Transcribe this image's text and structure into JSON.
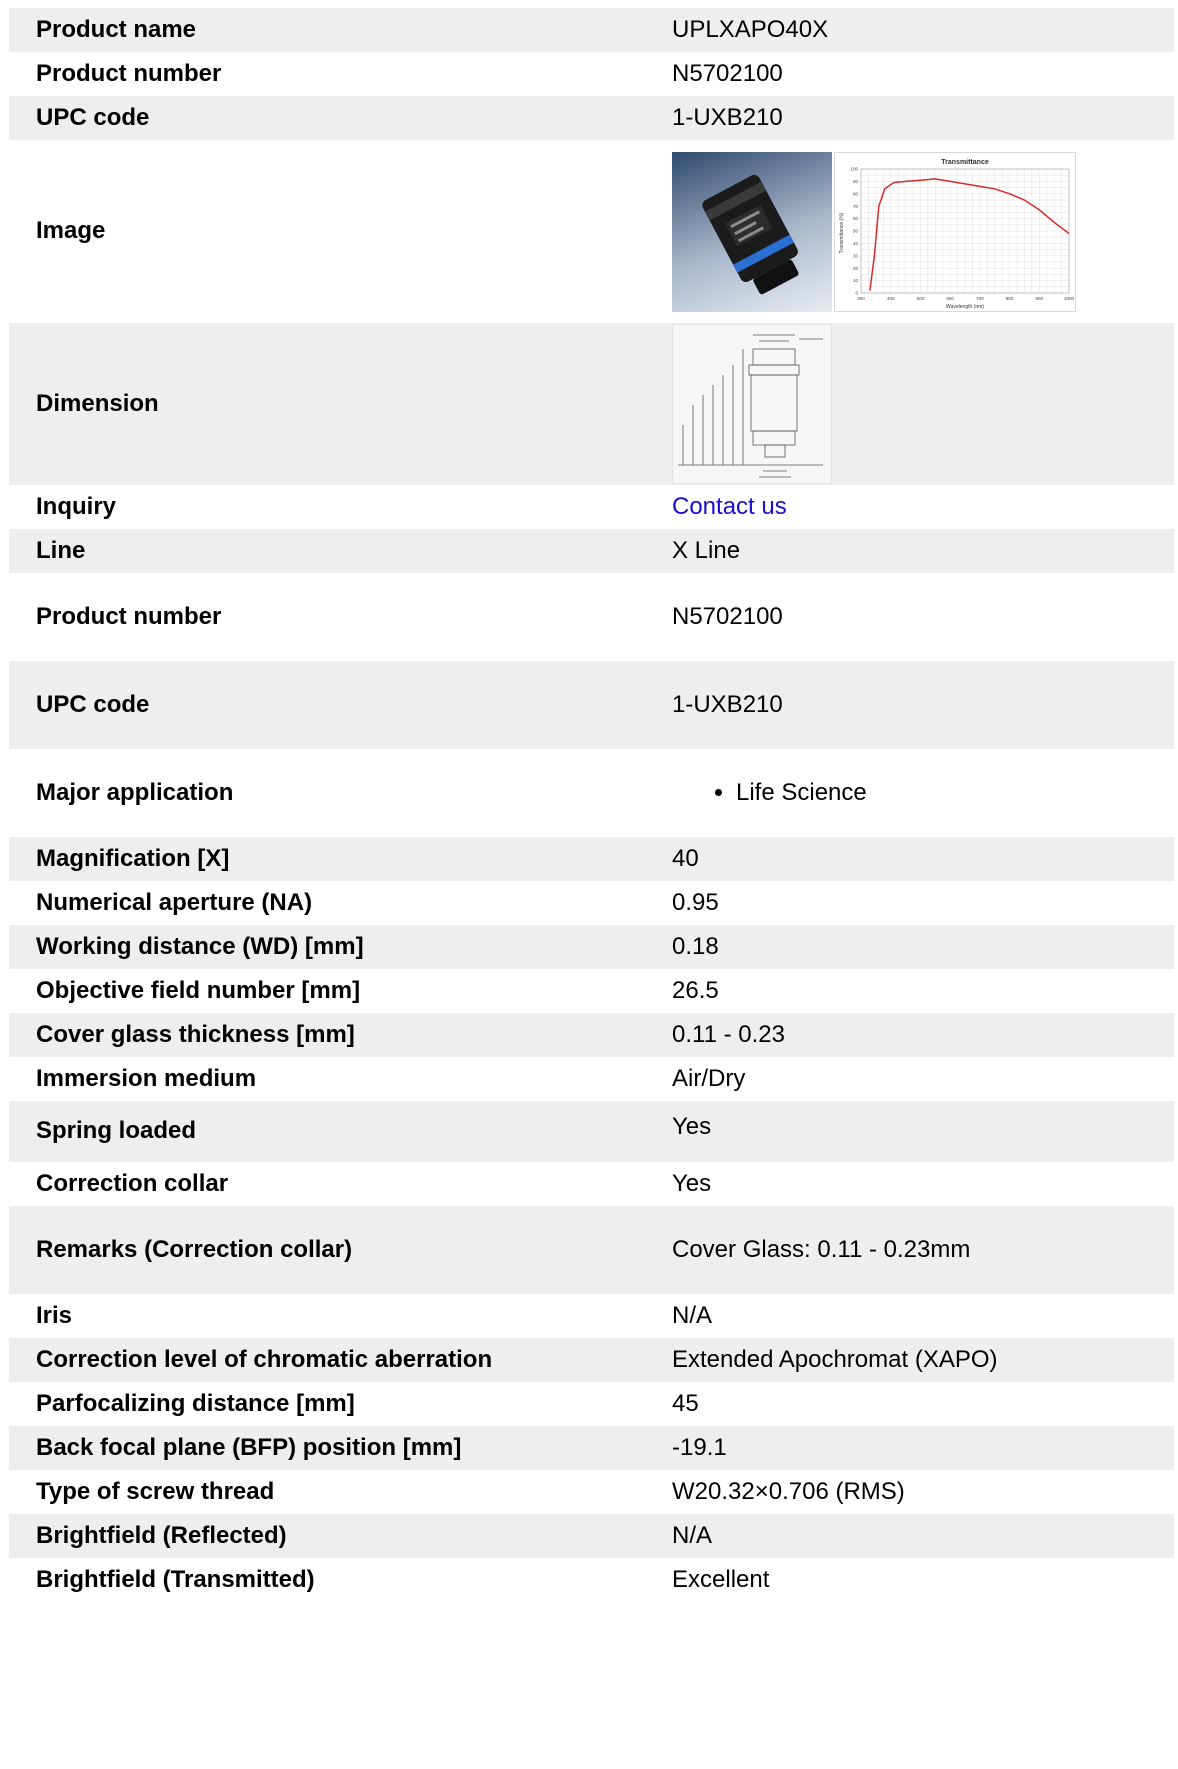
{
  "rows": [
    {
      "label": "Product name",
      "value": "UPLXAPO40X"
    },
    {
      "label": "Product number",
      "value": "N5702100"
    },
    {
      "label": "UPC code",
      "value": "1-UXB210"
    },
    {
      "label": "Image"
    },
    {
      "label": "Dimension"
    },
    {
      "label": "Inquiry",
      "link": "Contact us"
    },
    {
      "label": "Line",
      "value": "X Line"
    },
    {
      "label": "Product number",
      "value": "N5702100"
    },
    {
      "label": "UPC code",
      "value": "1-UXB210"
    },
    {
      "label": "Major application",
      "list": [
        "Life Science"
      ]
    },
    {
      "label": "Magnification [X]",
      "value": "40"
    },
    {
      "label": "Numerical aperture (NA)",
      "value": "0.95"
    },
    {
      "label": "Working distance (WD) [mm]",
      "value": "0.18"
    },
    {
      "label": "Objective field number [mm]",
      "value": "26.5"
    },
    {
      "label": "Cover glass thickness [mm]",
      "value": "0.11 - 0.23"
    },
    {
      "label": "Immersion medium",
      "value": "Air/Dry"
    },
    {
      "label": "Spring loaded",
      "value": "Yes"
    },
    {
      "label": "Correction collar",
      "value": "Yes"
    },
    {
      "label": "Remarks (Correction collar)",
      "value": "Cover Glass: 0.11 - 0.23mm"
    },
    {
      "label": "Iris",
      "value": "N/A"
    },
    {
      "label": "Correction level of chromatic aberration",
      "value": "Extended Apochromat (XAPO)"
    },
    {
      "label": "Parfocalizing distance [mm]",
      "value": "45"
    },
    {
      "label": "Back focal plane (BFP) position [mm]",
      "value": "-19.1"
    },
    {
      "label": "Type of screw thread",
      "value": "W20.32×0.706 (RMS)"
    },
    {
      "label": "Brightfield (Reflected)",
      "value": "N/A"
    },
    {
      "label": "Brightfield (Transmitted)",
      "value": "Excellent"
    }
  ],
  "colors": {
    "row_shaded": "#eeeeee",
    "link": "#1a0dcc",
    "curve": "#d62b2b"
  },
  "transmittance_chart": {
    "type": "line",
    "title": "Transmittance",
    "xlabel": "Wavelength (nm)",
    "ylabel": "Transmittance (%)",
    "x_ticks": [
      "300",
      "400",
      "500",
      "600",
      "700",
      "800",
      "900",
      "1000"
    ],
    "y_ticks": [
      "100",
      "90",
      "80",
      "70",
      "60",
      "50",
      "40",
      "30",
      "20",
      "10",
      "0"
    ],
    "xlim": [
      300,
      1000
    ],
    "ylim": [
      0,
      100
    ],
    "grid": true,
    "x": [
      330,
      345,
      360,
      380,
      410,
      450,
      500,
      550,
      600,
      700,
      750,
      800,
      850,
      900,
      950,
      1000
    ],
    "y": [
      2,
      30,
      70,
      84,
      89,
      90,
      91,
      92,
      90,
      86,
      84,
      80,
      75,
      67,
      57,
      48
    ]
  }
}
